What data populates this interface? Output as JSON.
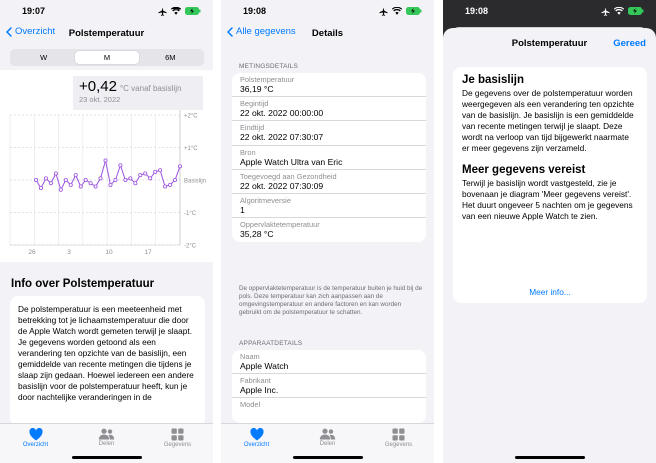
{
  "screen1": {
    "status_time": "19:07",
    "back_label": "Overzicht",
    "title": "Polstemperatuur",
    "segments": [
      "W",
      "M",
      "6M"
    ],
    "active_segment": "M",
    "readout_value": "+0,42",
    "readout_unit": "°C vanaf basislijn",
    "readout_date": "23 okt. 2022",
    "info_title": "Info over Polstemperatuur",
    "info_text": "De polstemperatuur is een meeteenheid met betrekking tot je lichaamstemperatuur die door de Apple Watch wordt gemeten terwijl je slaapt. Je gegevens worden getoond als een verandering ten opzichte van de basislijn, een gemiddelde van recente metingen die tijdens je slaap zijn gedaan. Hoewel iedereen een andere basislijn voor de polstemperatuur heeft, kun je door nachtelijke veranderingen in de"
  },
  "chart_data": {
    "type": "line",
    "y_ticks": [
      "+2°C",
      "+1°C",
      "Basislijn",
      "-1°C",
      "-2°C"
    ],
    "x_ticks": [
      "26",
      "3",
      "10",
      "17"
    ],
    "ylim": [
      -2,
      2
    ],
    "values": [
      0.0,
      -0.25,
      0.05,
      -0.1,
      0.2,
      -0.3,
      0.0,
      -0.15,
      0.15,
      -0.2,
      0.0,
      -0.1,
      -0.2,
      0.05,
      0.6,
      -0.15,
      0.0,
      0.45,
      0.0,
      0.05,
      -0.1,
      0.15,
      0.2,
      0.05,
      0.25,
      0.3,
      -0.2,
      -0.15,
      0.0,
      0.42
    ],
    "line_color": "#9b51e0"
  },
  "tabbar": {
    "items": [
      "Overzicht",
      "Delen",
      "Gegevens"
    ]
  },
  "screen2": {
    "status_time": "19:08",
    "back_label": "Alle gegevens",
    "title": "Details",
    "section1_label": "METINGSDETAILS",
    "rows": [
      {
        "k": "Polstemperatuur",
        "v": "36,19 °C"
      },
      {
        "k": "Begintijd",
        "v": "22 okt. 2022 00:00:00"
      },
      {
        "k": "Eindtijd",
        "v": "22 okt. 2022 07:30:07"
      },
      {
        "k": "Bron",
        "v": "Apple Watch Ultra van Eric"
      },
      {
        "k": "Toegevoegd aan Gezondheid",
        "v": "22 okt. 2022 07:30:09"
      },
      {
        "k": "Algoritmeversie",
        "v": "1"
      },
      {
        "k": "Oppervlaktetemperatuur",
        "v": "35,28 °C"
      }
    ],
    "note": "De oppervlaktetemperatuur is de temperatuur buiten je huid bij de pols. Deze temperatuur kan zich aanpassen aan de omgevingstemperatuur en andere factoren en kan worden gebruikt om de polstemperatuur te schatten.",
    "section2_label": "APPARAATDETAILS",
    "device_rows": [
      {
        "k": "Naam",
        "v": "Apple Watch"
      },
      {
        "k": "Fabrikant",
        "v": "Apple Inc."
      },
      {
        "k": "Model",
        "v": ""
      }
    ]
  },
  "screen3": {
    "status_time": "19:08",
    "title": "Polstemperatuur",
    "done_label": "Gereed",
    "h1": "Je basislijn",
    "p1": "De gegevens over de polstemperatuur worden weergegeven als een verandering ten opzichte van de basislijn. Je basislijn is een gemiddelde van recente metingen terwijl je slaapt. Deze wordt na verloop van tijd bijgewerkt naarmate er meer gegevens zijn verzameld.",
    "h2": "Meer gegevens vereist",
    "p2": "Terwijl je basislijn wordt vastgesteld, zie je bovenaan je diagram 'Meer gegevens vereist'. Het duurt ongeveer 5 nachten om je gegevens van een nieuwe Apple Watch te zien.",
    "more_label": "Meer info..."
  }
}
